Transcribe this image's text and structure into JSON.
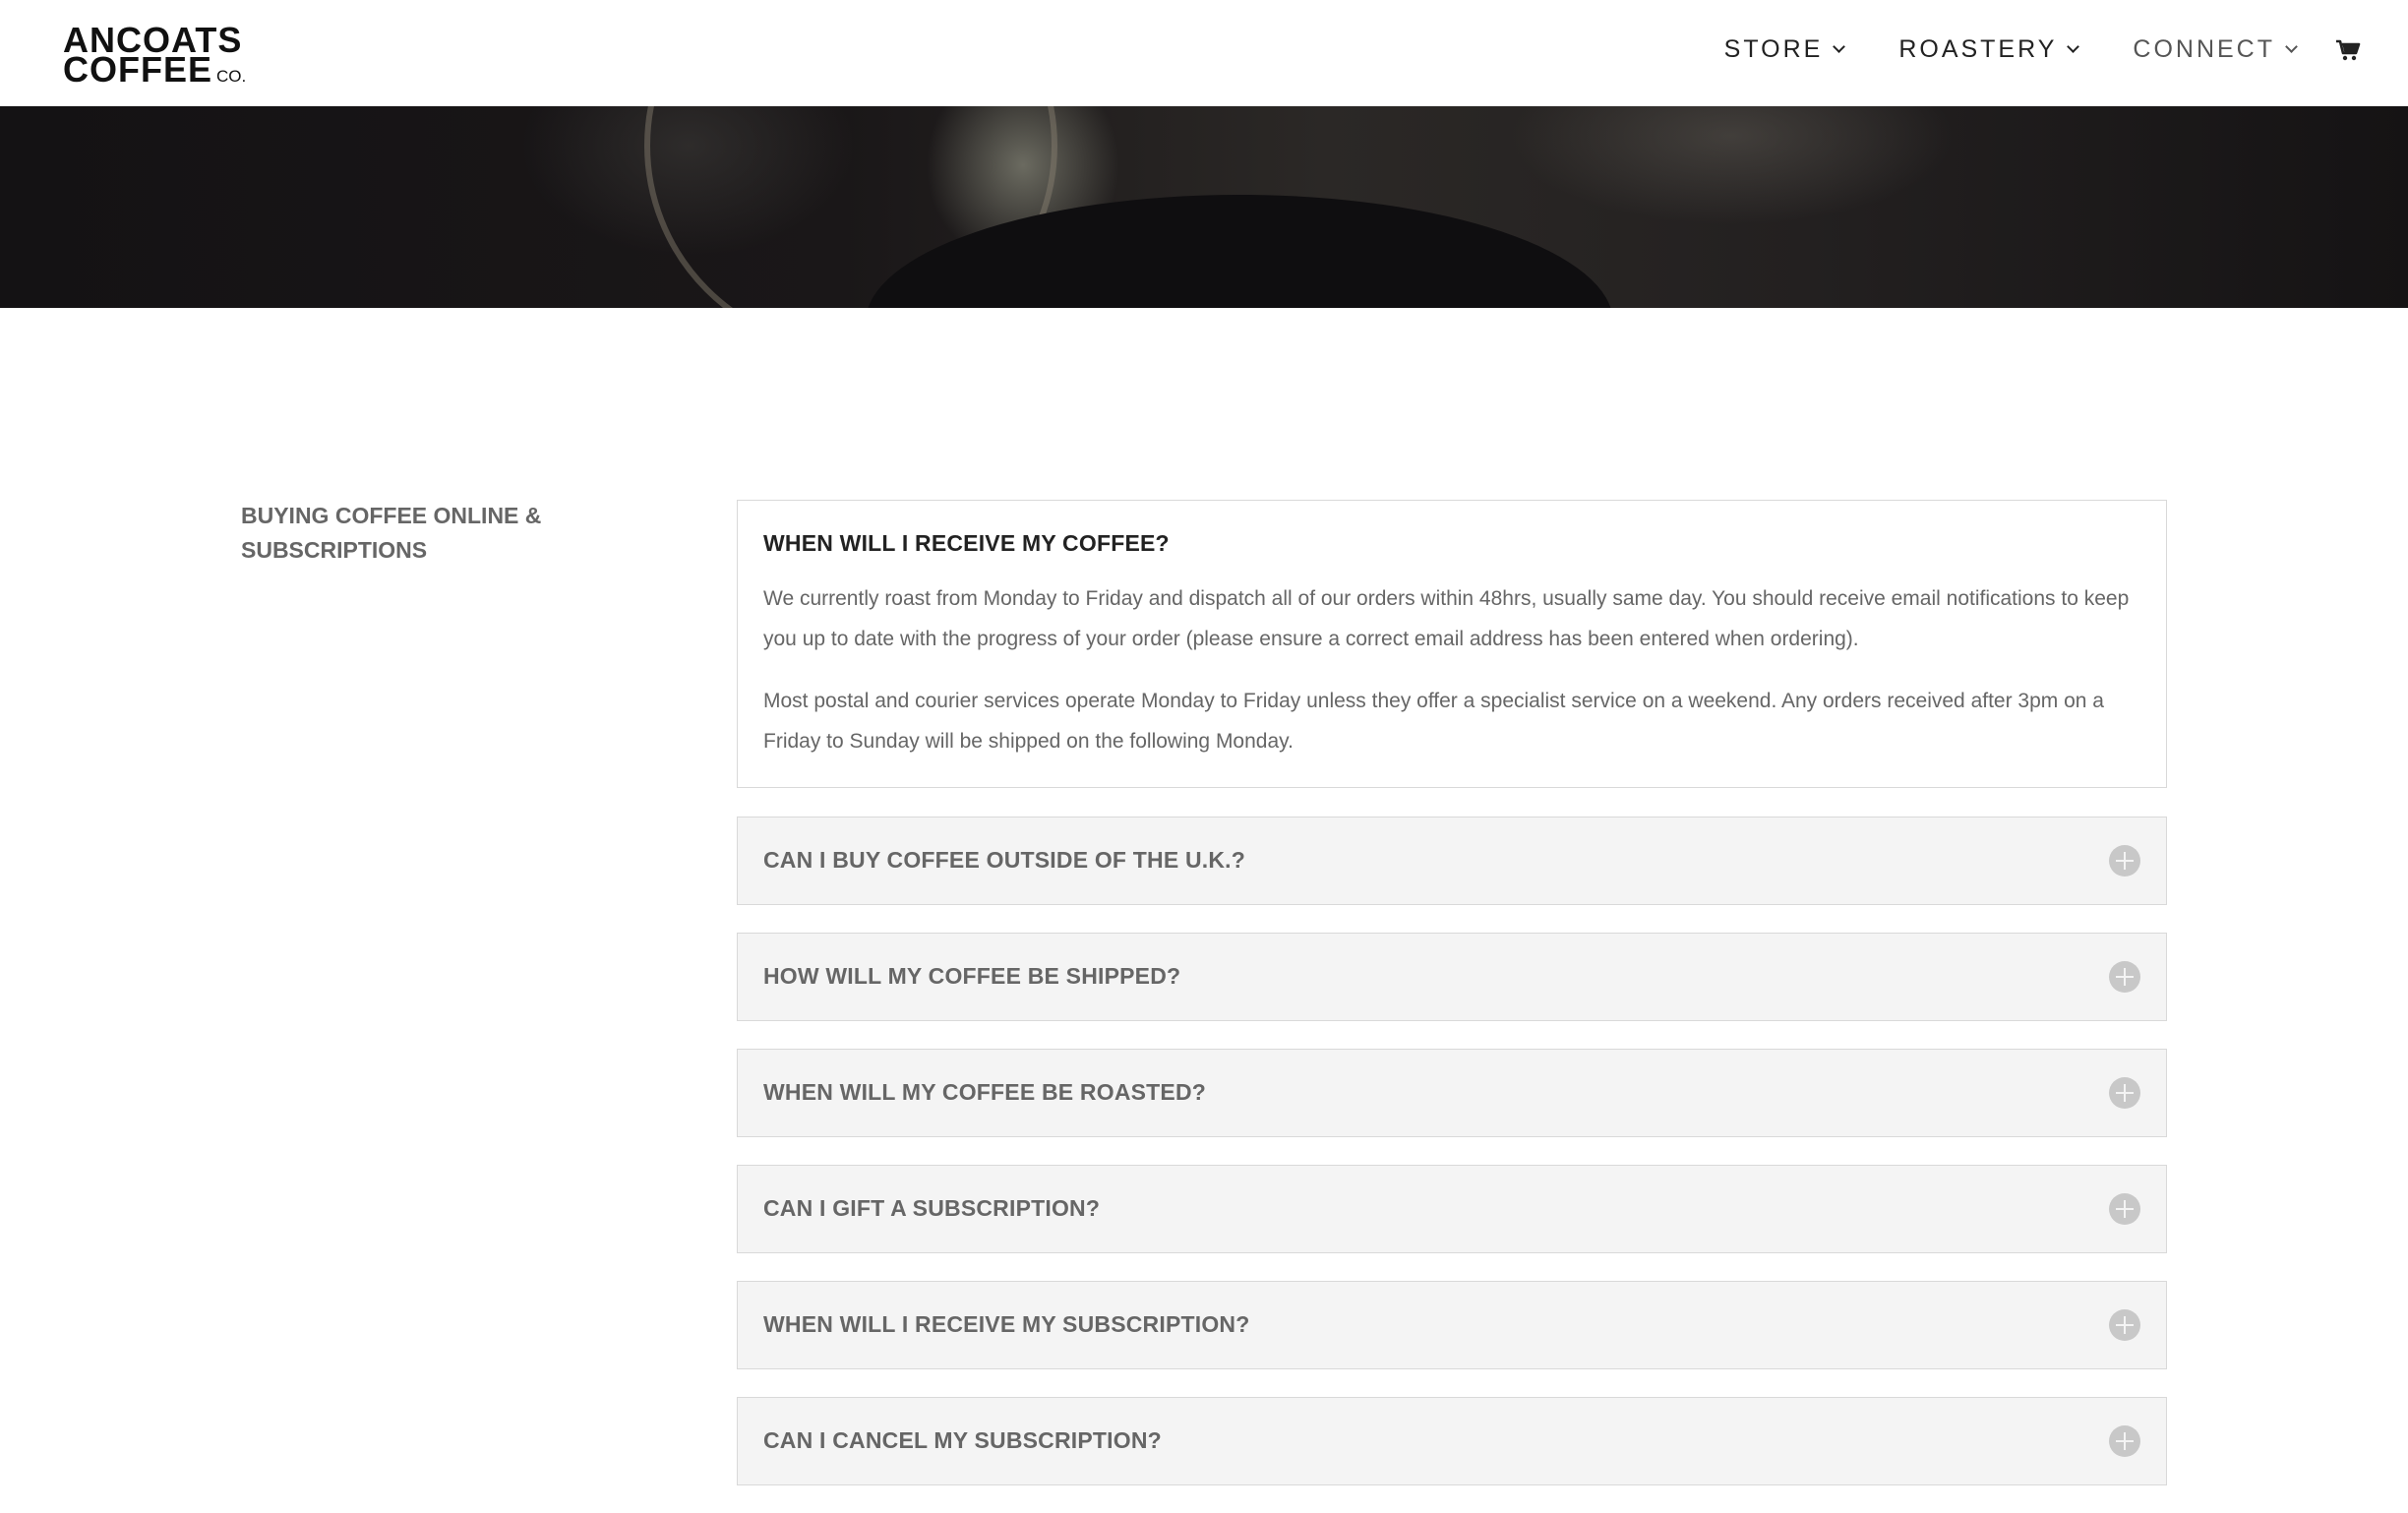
{
  "header": {
    "logo": {
      "line1": "ANCOATS",
      "line2": "COFFEE",
      "suffix": "CO."
    },
    "nav": [
      {
        "label": "STORE"
      },
      {
        "label": "ROASTERY"
      },
      {
        "label": "CONNECT"
      }
    ],
    "cart_icon": "cart-icon"
  },
  "sidebar": {
    "section_title": "BUYING COFFEE ONLINE & SUBSCRIPTIONS"
  },
  "faq": {
    "open": {
      "question": "WHEN WILL I RECEIVE MY COFFEE?",
      "answers": [
        "We currently roast from Monday to Friday and dispatch all of our orders within 48hrs, usually same day. You should receive email notifications to keep you up to date with the progress of your order (please ensure a correct email address has been entered when ordering).",
        "Most postal and courier services operate Monday to Friday unless they offer a specialist service on a weekend. Any orders received after 3pm on a Friday to Sunday will be shipped on the following Monday."
      ]
    },
    "closed": [
      {
        "question": "CAN I BUY COFFEE OUTSIDE OF THE U.K.?"
      },
      {
        "question": "HOW WILL MY COFFEE BE SHIPPED?"
      },
      {
        "question": "WHEN WILL MY COFFEE BE ROASTED?"
      },
      {
        "question": "CAN I GIFT A SUBSCRIPTION?"
      },
      {
        "question": "WHEN WILL I RECEIVE MY SUBSCRIPTION?"
      },
      {
        "question": "CAN I CANCEL MY SUBSCRIPTION?"
      }
    ],
    "toggle_icon": "plus-circle-icon"
  }
}
